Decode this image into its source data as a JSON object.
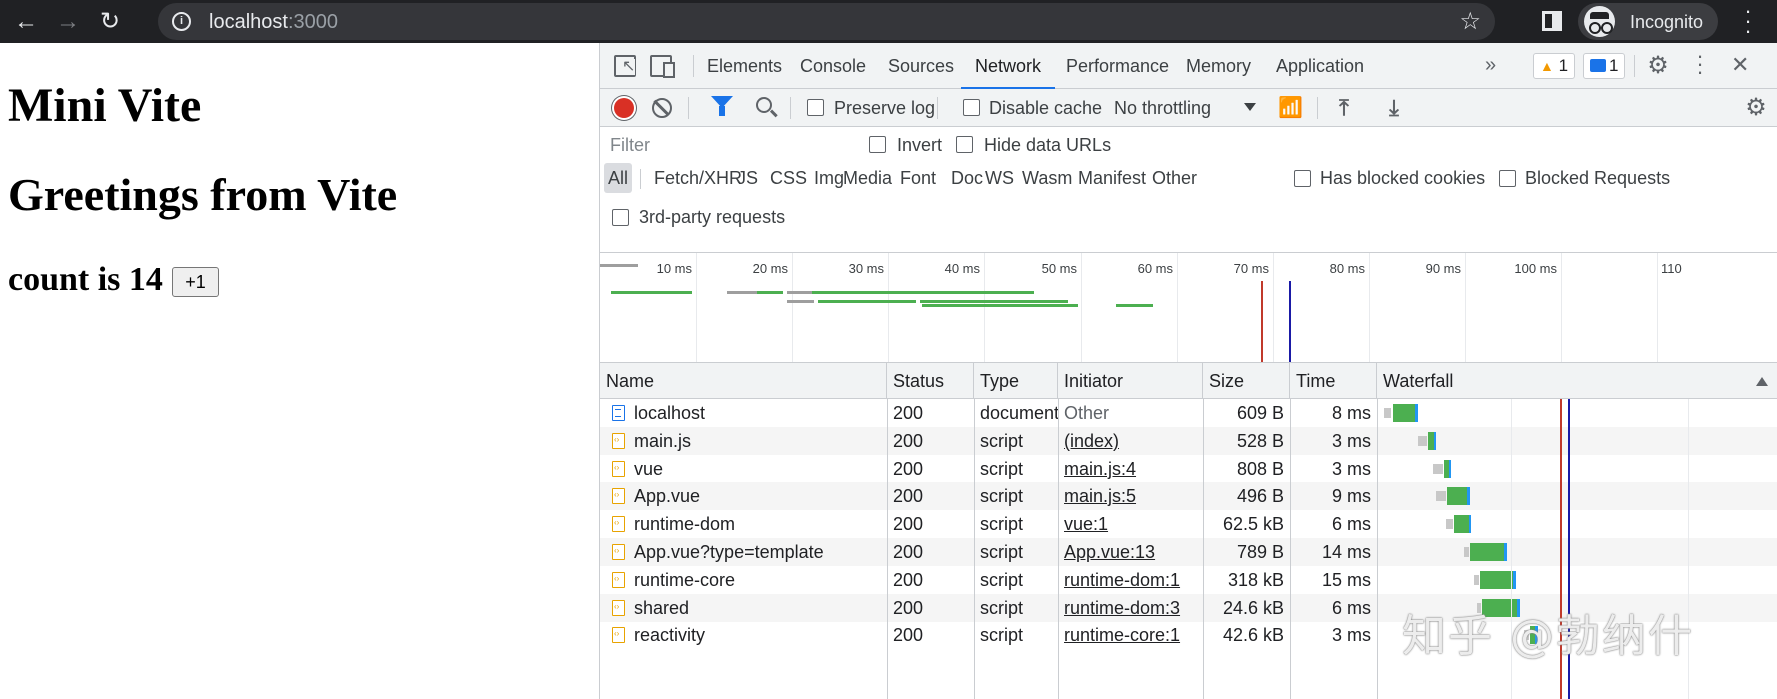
{
  "browser": {
    "url_host": "localhost",
    "url_port": ":3000",
    "profile_label": "Incognito",
    "icons": [
      "back-arrow-icon",
      "forward-arrow-icon",
      "reload-icon",
      "info-icon",
      "star-icon",
      "side-panel-icon",
      "incognito-icon",
      "menu-dots-icon"
    ]
  },
  "page": {
    "title": "Mini Vite",
    "subtitle": "Greetings from Vite",
    "counter_text": "count is 14",
    "increment_label": "+1"
  },
  "devtools": {
    "tabs": [
      "Elements",
      "Console",
      "Sources",
      "Network",
      "Performance",
      "Memory",
      "Application"
    ],
    "active_tab": "Network",
    "more_tabs": "»",
    "warning_count": "1",
    "message_count": "1",
    "toolbar": {
      "preserve_log": "Preserve log",
      "disable_cache": "Disable cache",
      "throttling": "No throttling"
    },
    "filter": {
      "placeholder": "Filter",
      "invert": "Invert",
      "hide_data_urls": "Hide data URLs",
      "types": [
        "All",
        "Fetch/XHR",
        "JS",
        "CSS",
        "Img",
        "Media",
        "Font",
        "Doc",
        "WS",
        "Wasm",
        "Manifest",
        "Other"
      ],
      "has_blocked_cookies": "Has blocked cookies",
      "blocked_requests": "Blocked Requests",
      "third_party": "3rd-party requests"
    },
    "overview": {
      "ticks": [
        "10 ms",
        "20 ms",
        "30 ms",
        "40 ms",
        "50 ms",
        "60 ms",
        "70 ms",
        "80 ms",
        "90 ms",
        "100 ms",
        "110"
      ],
      "colors": {
        "dom_content_loaded": "#1a1aa6",
        "load": "#c0392b",
        "download": "#4caf50",
        "waiting": "#9e9e9e"
      }
    },
    "columns": [
      "Name",
      "Status",
      "Type",
      "Initiator",
      "Size",
      "Time",
      "Waterfall"
    ],
    "requests": [
      {
        "name": "localhost",
        "status": "200",
        "type": "document",
        "initiator": "Other",
        "size": "609 B",
        "time": "8 ms",
        "icon": "document-icon"
      },
      {
        "name": "main.js",
        "status": "200",
        "type": "script",
        "initiator": "(index)",
        "size": "528 B",
        "time": "3 ms",
        "icon": "script-icon"
      },
      {
        "name": "vue",
        "status": "200",
        "type": "script",
        "initiator": "main.js:4",
        "size": "808 B",
        "time": "3 ms",
        "icon": "script-icon"
      },
      {
        "name": "App.vue",
        "status": "200",
        "type": "script",
        "initiator": "main.js:5",
        "size": "496 B",
        "time": "9 ms",
        "icon": "script-icon"
      },
      {
        "name": "runtime-dom",
        "status": "200",
        "type": "script",
        "initiator": "vue:1",
        "size": "62.5 kB",
        "time": "6 ms",
        "icon": "script-icon"
      },
      {
        "name": "App.vue?type=template",
        "status": "200",
        "type": "script",
        "initiator": "App.vue:13",
        "size": "789 B",
        "time": "14 ms",
        "icon": "script-icon"
      },
      {
        "name": "runtime-core",
        "status": "200",
        "type": "script",
        "initiator": "runtime-dom:1",
        "size": "318 kB",
        "time": "15 ms",
        "icon": "script-icon"
      },
      {
        "name": "shared",
        "status": "200",
        "type": "script",
        "initiator": "runtime-dom:3",
        "size": "24.6 kB",
        "time": "6 ms",
        "icon": "script-icon"
      },
      {
        "name": "reactivity",
        "status": "200",
        "type": "script",
        "initiator": "runtime-core:1",
        "size": "42.6 kB",
        "time": "3 ms",
        "icon": "script-icon"
      }
    ]
  },
  "watermark": "知乎 @勃纳什"
}
